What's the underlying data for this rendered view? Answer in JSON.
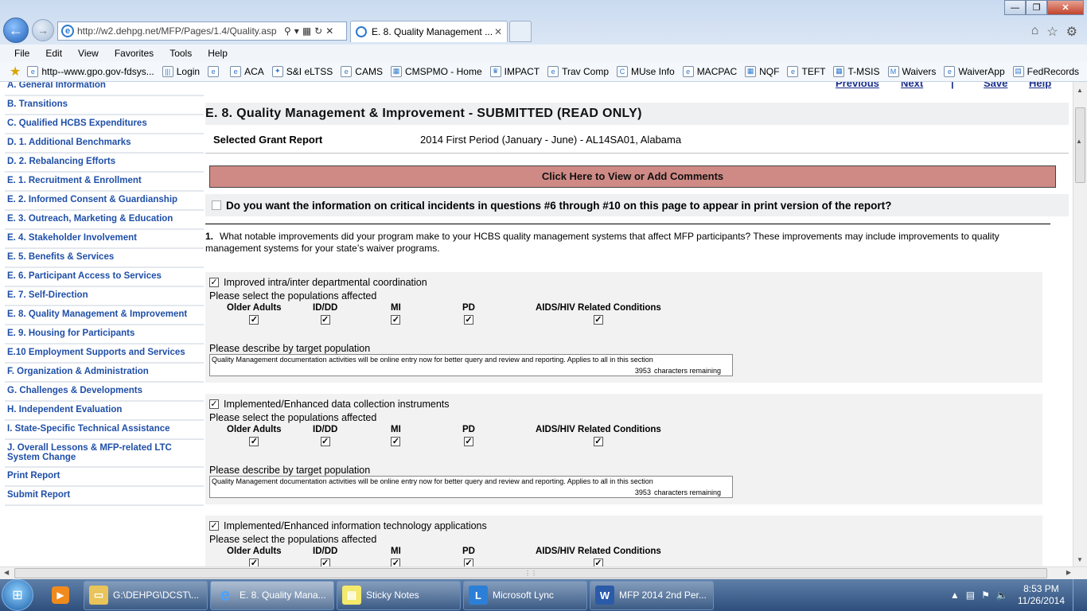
{
  "browser": {
    "url": "http://w2.dehpg.net/MFP/Pages/1.4/Quality.asp",
    "tab_title": "E. 8. Quality Management ...",
    "window_controls": {
      "minimize": "—",
      "maximize": "❐",
      "close": "✕"
    }
  },
  "menu": [
    "File",
    "Edit",
    "View",
    "Favorites",
    "Tools",
    "Help"
  ],
  "favorites": [
    {
      "label": "http--www.gpo.gov-fdsys...",
      "icon": "ie-page-icon"
    },
    {
      "label": "Login",
      "icon": "bars-icon"
    },
    {
      "label": "",
      "icon": "ie-page-icon"
    },
    {
      "label": "ACA",
      "icon": "ie-page-icon"
    },
    {
      "label": "S&I eLTSS",
      "icon": "leaf-icon"
    },
    {
      "label": "CAMS",
      "icon": "ie-page-icon"
    },
    {
      "label": "CMSPMO - Home",
      "icon": "grid-icon"
    },
    {
      "label": "IMPACT",
      "icon": "shield-icon"
    },
    {
      "label": "Trav Comp",
      "icon": "ie-page-icon"
    },
    {
      "label": "MUse Info",
      "icon": "cdc-icon"
    },
    {
      "label": "MACPAC",
      "icon": "ie-page-icon"
    },
    {
      "label": "NQF",
      "icon": "grid-icon"
    },
    {
      "label": "TEFT",
      "icon": "ie-page-icon"
    },
    {
      "label": "T-MSIS",
      "icon": "grid-icon"
    },
    {
      "label": "Waivers",
      "icon": "m-icon"
    },
    {
      "label": "WaiverApp",
      "icon": "ie-page-icon"
    },
    {
      "label": "FedRecords",
      "icon": "doc-icon"
    }
  ],
  "sidebar": [
    "A. General Information",
    "B. Transitions",
    "C. Qualified HCBS Expenditures",
    "D. 1. Additional Benchmarks",
    "D. 2. Rebalancing Efforts",
    "E. 1. Recruitment & Enrollment",
    "E. 2. Informed Consent & Guardianship",
    "E. 3. Outreach, Marketing & Education",
    "E. 4. Stakeholder Involvement",
    "E. 5. Benefits & Services",
    "E. 6. Participant Access to Services",
    "E. 7. Self-Direction",
    "E. 8. Quality Management & Improvement",
    "E. 9. Housing for Participants",
    "E.10 Employment Supports and Services",
    "F. Organization & Administration",
    "G. Challenges & Developments",
    "H. Independent Evaluation",
    "I. State-Specific Technical Assistance",
    "J. Overall Lessons & MFP-related LTC System Change",
    "Print Report",
    "Submit Report"
  ],
  "topnav": {
    "previous": "Previous",
    "next": "Next",
    "sep": "|",
    "save": "Save",
    "help": "Help"
  },
  "page": {
    "title": "E. 8. Quality Management & Improvement - SUBMITTED (READ ONLY)",
    "selected_label": "Selected Grant Report",
    "selected_value": "2014 First Period (January - June) - AL14SA01, Alabama",
    "comments_button": "Click Here to View or Add Comments",
    "critical_question": "Do you want the information on critical incidents in questions #6 through #10 on this page to appear in print version of the report?",
    "q1_number": "1.",
    "q1_text": "What notable improvements did your program make to your HCBS quality management systems that affect MFP participants? These improvements may include improvements to quality management systems for your state’s waiver programs."
  },
  "populations": [
    "Older Adults",
    "ID/DD",
    "MI",
    "PD",
    "AIDS/HIV Related Conditions"
  ],
  "labels": {
    "select_populations": "Please select the populations affected",
    "describe": "Please describe by target population",
    "chars_remaining": "characters remaining"
  },
  "improvements": [
    {
      "label": "Improved intra/inter departmental coordination",
      "description": "Quality Management documentation activities will be online entry now for better query and review and reporting. Applies to all in this section",
      "remaining": "3953"
    },
    {
      "label": "Implemented/Enhanced data collection instruments",
      "description": "Quality Management documentation activities will be online entry now for better query and review and reporting. Applies to all in this section",
      "remaining": "3953"
    },
    {
      "label": "Implemented/Enhanced information technology applications"
    }
  ],
  "taskbar": {
    "items": [
      {
        "label": "G:\\DEHPG\\DCST\\...",
        "icon": "folder-icon"
      },
      {
        "label": "E. 8. Quality Mana...",
        "icon": "ie-icon"
      },
      {
        "label": "Sticky Notes",
        "icon": "sticky-notes-icon"
      },
      {
        "label": "Microsoft Lync",
        "icon": "lync-icon"
      },
      {
        "label": "MFP 2014 2nd Per...",
        "icon": "word-icon"
      }
    ],
    "time": "8:53 PM",
    "date": "11/26/2014"
  }
}
